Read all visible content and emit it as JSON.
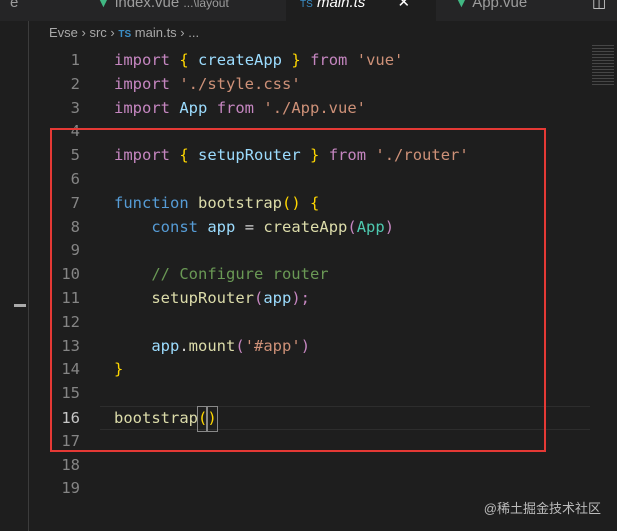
{
  "tabs": [
    {
      "label": "e"
    },
    {
      "label": "index.vue",
      "hint": "...\\layout",
      "icon": "vue-icon"
    },
    {
      "label": "main.ts",
      "icon": "ts-icon",
      "active": true
    },
    {
      "label": "App.vue",
      "icon": "vue-icon"
    }
  ],
  "breadcrumb": {
    "root": "Evse",
    "folder": "src",
    "ts_badge": "TS",
    "file": "main.ts",
    "more": "..."
  },
  "lines": [
    "1",
    "2",
    "3",
    "4",
    "5",
    "6",
    "7",
    "8",
    "9",
    "10",
    "11",
    "12",
    "13",
    "14",
    "15",
    "16",
    "17",
    "18",
    "19"
  ],
  "code": {
    "l1": [
      "import",
      "{",
      "createApp",
      "}",
      "from",
      "'vue'"
    ],
    "l2": [
      "import",
      "'./style.css'"
    ],
    "l3": [
      "import",
      "App",
      "from",
      "'./App.vue'"
    ],
    "l5": [
      "import",
      "{",
      "setupRouter",
      "}",
      "from",
      "'./router'"
    ],
    "l7": [
      "function",
      "bootstrap",
      "()",
      "{"
    ],
    "l8": [
      "const",
      "app",
      "=",
      "createApp",
      "(",
      "App",
      ")"
    ],
    "l10": "// Configure router",
    "l11": [
      "setupRouter",
      "(",
      "app",
      ");"
    ],
    "l13": [
      "app",
      ".",
      "mount",
      "(",
      "'#app'",
      ")"
    ],
    "l14": "}",
    "l16": [
      "bootstrap",
      "(",
      ")"
    ]
  },
  "watermark": "@稀土掘金技术社区"
}
